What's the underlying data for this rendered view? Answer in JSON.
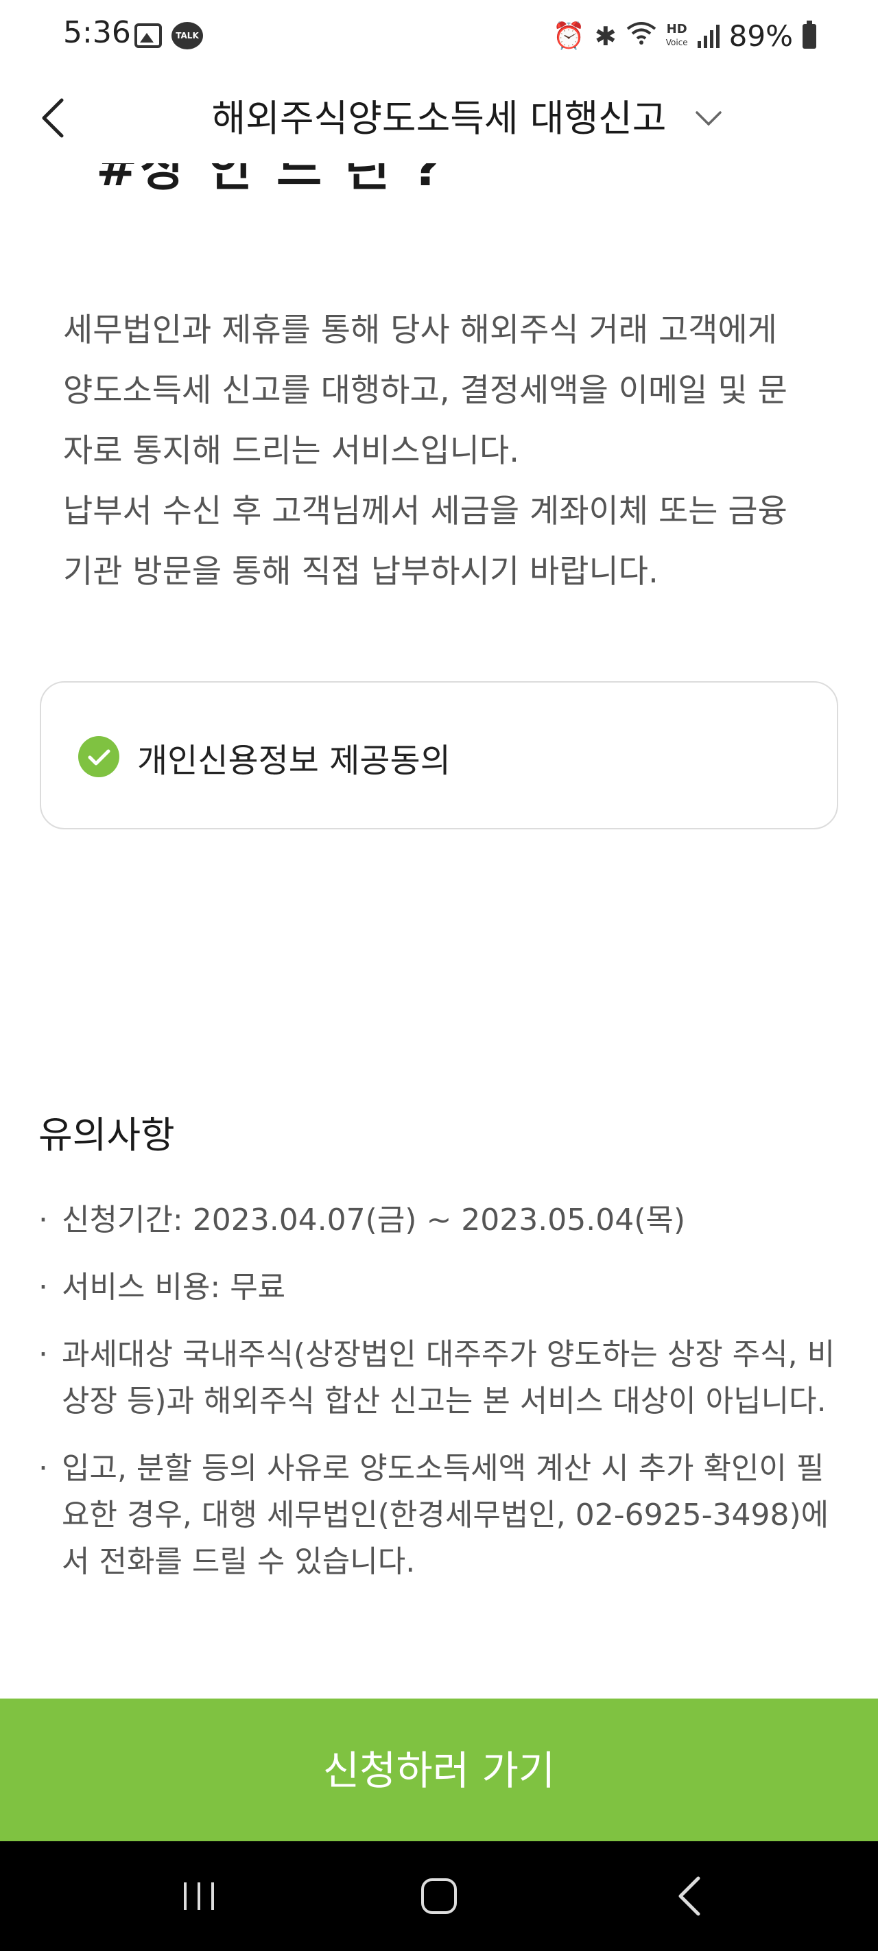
{
  "status_bar": {
    "time": "5:36",
    "talk_badge": "TALK",
    "hd_label": "HD",
    "voice_label": "Voice",
    "battery": "89%"
  },
  "header": {
    "title": "해외주식양도소득세 대행신고",
    "back_icon": "chevron-left-icon",
    "dropdown_icon": "chevron-down-icon"
  },
  "intro": {
    "clipped_heading": "#상 안 드 린 ?",
    "lines": [
      "세무법인과 제휴를 통해 당사 해외주식 거래 고객에게",
      "양도소득세 신고를 대행하고, 결정세액을 이메일 및 문",
      "자로 통지해 드리는 서비스입니다.",
      "납부서 수신 후 고객님께서 세금을 계좌이체 또는 금융",
      "기관 방문을 통해 직접 납부하시기 바랍니다."
    ]
  },
  "consent": {
    "label": "개인신용정보 제공동의",
    "checked": true,
    "check_color": "#7fc241"
  },
  "notice": {
    "title": "유의사항",
    "bullet": "·",
    "items": [
      "신청기간: 2023.04.07(금) ~ 2023.05.04(목)",
      "서비스 비용: 무료",
      "과세대상 국내주식(상장법인 대주주가 양도하는 상장 주식, 비상장 등)과 해외주식 합산 신고는 본 서비스 대상이 아닙니다.",
      "입고, 분할 등의 사유로 양도소득세액 계산 시 추가 확인이 필요한 경우, 대행 세무법인(한경세무법인, 02-6925-3498)에서 전화를 드릴 수 있습니다."
    ]
  },
  "cta": {
    "label": "신청하러 가기",
    "color": "#7fc241"
  },
  "nav": {
    "recent_icon": "recent-apps-icon",
    "home_icon": "home-icon",
    "back_icon": "back-icon"
  }
}
